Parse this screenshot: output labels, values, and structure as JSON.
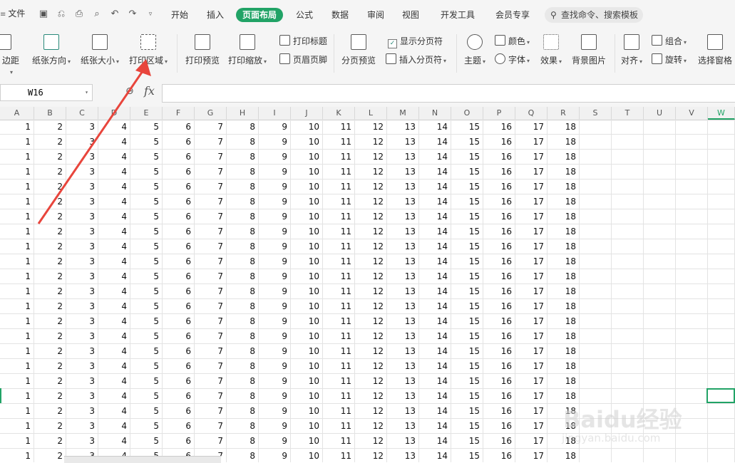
{
  "menubar": {
    "file_label": "文件",
    "tabs": [
      {
        "label": "开始",
        "active": false
      },
      {
        "label": "插入",
        "active": false
      },
      {
        "label": "页面布局",
        "active": true
      },
      {
        "label": "公式",
        "active": false
      },
      {
        "label": "数据",
        "active": false
      },
      {
        "label": "审阅",
        "active": false
      },
      {
        "label": "视图",
        "active": false
      },
      {
        "label": "开发工具",
        "active": false
      },
      {
        "label": "会员专享",
        "active": false
      }
    ],
    "search_placeholder": "查找命令、搜索模板"
  },
  "ribbon": {
    "margins": "边距",
    "orientation": "纸张方向",
    "size": "纸张大小",
    "print_area": "打印区域",
    "print_preview": "打印预览",
    "print_scale": "打印缩放",
    "print_titles": "打印标题",
    "header_footer": "页眉页脚",
    "page_break_preview": "分页预览",
    "show_page_breaks": "显示分页符",
    "insert_page_break": "插入分页符",
    "theme": "主题",
    "colors": "颜色",
    "fonts": "字体",
    "effects": "效果",
    "background": "背景图片",
    "align": "对齐",
    "group": "组合",
    "rotate": "旋转",
    "selection_pane": "选择窗格"
  },
  "formula": {
    "name_box": "W16",
    "fx": "fx",
    "value": ""
  },
  "columns": [
    "A",
    "B",
    "C",
    "D",
    "E",
    "F",
    "G",
    "H",
    "I",
    "J",
    "K",
    "L",
    "M",
    "N",
    "O",
    "P",
    "Q",
    "R",
    "S",
    "T",
    "U",
    "V",
    "W"
  ],
  "selected_column": "W",
  "row_values": [
    "1",
    "2",
    "3",
    "4",
    "5",
    "6",
    "7",
    "8",
    "9",
    "10",
    "11",
    "12",
    "13",
    "14",
    "15",
    "16",
    "17",
    "18"
  ],
  "row_count": 23,
  "watermark": {
    "line1": "Baidu经验",
    "line2": "jingyan.baidu.com"
  },
  "colors": {
    "accent": "#21a366",
    "arrow": "#e8453c"
  }
}
